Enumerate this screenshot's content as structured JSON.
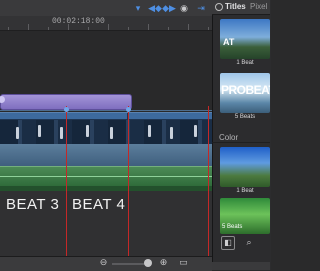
{
  "timeline": {
    "timecode": "00:02:18:00",
    "toolbar_icons": [
      "marker-icon",
      "keyframe-prev-icon",
      "keyframe-next-icon",
      "audio-skim-icon",
      "snapping-icon"
    ],
    "beat_labels": [
      "BEAT 3",
      "BEAT 4"
    ]
  },
  "browser": {
    "tab_titles": "Titles",
    "tab_pixel": "Pixel",
    "section_color": "Color",
    "items": [
      {
        "label": "1 Beat",
        "tile_text": "AT"
      },
      {
        "label": "5 Beats",
        "tile_text": "PROBEAT"
      },
      {
        "label": "1 Beat",
        "tile_text": ""
      },
      {
        "label": "5 Beats",
        "tile_text": ""
      }
    ]
  },
  "colors": {
    "marker": "#c42828",
    "title_clip": "#9c8cd4",
    "accent": "#4e8fe3"
  }
}
